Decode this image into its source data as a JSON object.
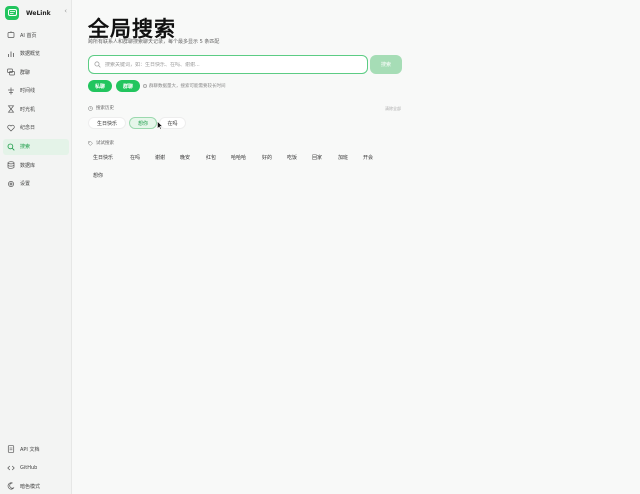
{
  "app": {
    "name": "WeLink",
    "collapse_icon": "chevron-left-icon"
  },
  "nav": {
    "items": [
      {
        "key": "ai",
        "label": "AI 首页",
        "icon": "sparkle-icon"
      },
      {
        "key": "overview",
        "label": "数据概览",
        "icon": "bar-chart-icon"
      },
      {
        "key": "groups",
        "label": "群聊",
        "icon": "chat-bubbles-icon"
      },
      {
        "key": "timeline",
        "label": "时间线",
        "icon": "timeline-icon"
      },
      {
        "key": "timemachine",
        "label": "时光机",
        "icon": "hourglass-icon"
      },
      {
        "key": "memorial",
        "label": "纪念日",
        "icon": "heart-icon"
      },
      {
        "key": "search",
        "label": "搜索",
        "icon": "search-icon",
        "active": true
      },
      {
        "key": "database",
        "label": "数据库",
        "icon": "database-icon"
      },
      {
        "key": "settings",
        "label": "设置",
        "icon": "gear-icon"
      }
    ],
    "bottom": [
      {
        "key": "api",
        "label": "API 文档",
        "icon": "doc-icon"
      },
      {
        "key": "github",
        "label": "GitHub",
        "icon": "code-icon"
      },
      {
        "key": "dark",
        "label": "暗色模式",
        "icon": "moon-icon"
      }
    ]
  },
  "page": {
    "title": "全局搜索",
    "subtitle": "跨所有联系人和群聊搜索聊天记录，每个最多显示 5 条匹配"
  },
  "search": {
    "placeholder": "搜索关键词，如：生日快乐、在吗、谢谢...",
    "value": "",
    "button_label": "搜索"
  },
  "scope": {
    "private_label": "私聊",
    "group_label": "群聊",
    "hint": "群聊数据量大，搜索可能需要较长时间"
  },
  "history": {
    "label": "搜索历史",
    "clear_label": "清除全部",
    "items": [
      "生日快乐",
      "想你",
      "在吗"
    ],
    "hovered_index": 1
  },
  "suggestions": {
    "label": "试试搜索",
    "items": [
      "生日快乐",
      "在吗",
      "谢谢",
      "晚安",
      "红包",
      "哈哈哈",
      "好的",
      "吃饭",
      "回家",
      "加班",
      "开会",
      "想你"
    ]
  },
  "colors": {
    "accent": "#22c55e",
    "accent_light": "#a6ddb6",
    "active_bg": "#e4f3e8"
  }
}
